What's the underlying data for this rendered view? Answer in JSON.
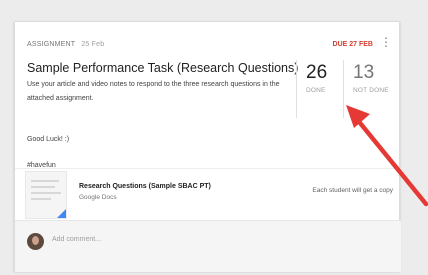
{
  "assignment": {
    "kind": "ASSIGNMENT",
    "posted_date": "25 Feb",
    "due": "DUE 27 FEB",
    "title": "Sample Performance Task (Research Questions)",
    "description": "Use your article and video notes to respond to the three research questions in the attached assignment.",
    "line1": "Good Luck! :)",
    "line2": "#havefun"
  },
  "stats": {
    "done_count": "26",
    "done_label": "DONE",
    "not_done_count": "13",
    "not_done_label": "NOT DONE"
  },
  "attachment": {
    "title": "Research Questions (Sample SBAC PT)",
    "type": "Google Docs",
    "note": "Each student will get a copy"
  },
  "comment": {
    "placeholder": "Add comment..."
  },
  "colors": {
    "due_red": "#d23f31",
    "arrow_red": "#e53935",
    "doc_corner_blue": "#4285f4"
  },
  "icons": [
    "more-vert-icon",
    "google-doc-thumbnail-icon",
    "user-avatar",
    "annotation-arrow"
  ]
}
